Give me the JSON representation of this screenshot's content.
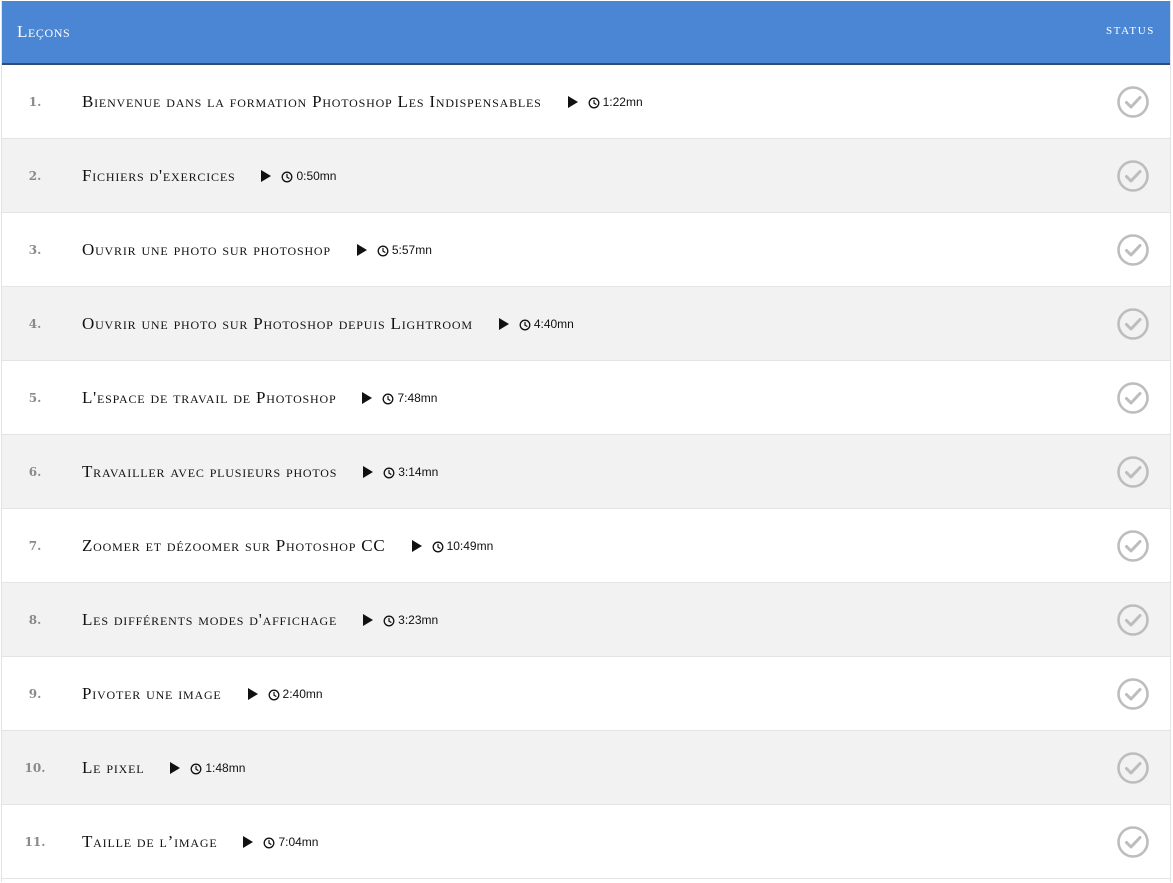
{
  "header": {
    "title": "Leçons",
    "status_label": "STATUS"
  },
  "colors": {
    "header_bg": "#4a86d4",
    "header_border": "#2e4e78",
    "row_alt_bg": "#f2f2f2",
    "check_gray": "#bdbdbd"
  },
  "icons": {
    "play": "play-icon",
    "clock": "clock-icon",
    "status": "check-circle-icon"
  },
  "lessons": [
    {
      "number": "1.",
      "title": "Bienvenue dans la formation Photoshop Les Indispensables",
      "duration": "1:22mn"
    },
    {
      "number": "2.",
      "title": "Fichiers d'exercices",
      "duration": "0:50mn"
    },
    {
      "number": "3.",
      "title": "Ouvrir une photo sur photoshop",
      "duration": "5:57mn"
    },
    {
      "number": "4.",
      "title": "Ouvrir une photo sur Photoshop depuis Lightroom",
      "duration": "4:40mn"
    },
    {
      "number": "5.",
      "title": "L'espace de travail de Photoshop",
      "duration": "7:48mn"
    },
    {
      "number": "6.",
      "title": "Travailler avec plusieurs photos",
      "duration": "3:14mn"
    },
    {
      "number": "7.",
      "title": "Zoomer et dézoomer sur Photoshop CC",
      "duration": "10:49mn"
    },
    {
      "number": "8.",
      "title": "Les différents modes d'affichage",
      "duration": "3:23mn"
    },
    {
      "number": "9.",
      "title": "Pivoter une image",
      "duration": "2:40mn"
    },
    {
      "number": "10.",
      "title": "Le pixel",
      "duration": "1:48mn"
    },
    {
      "number": "11.",
      "title": "Taille de l’image",
      "duration": "7:04mn"
    }
  ]
}
